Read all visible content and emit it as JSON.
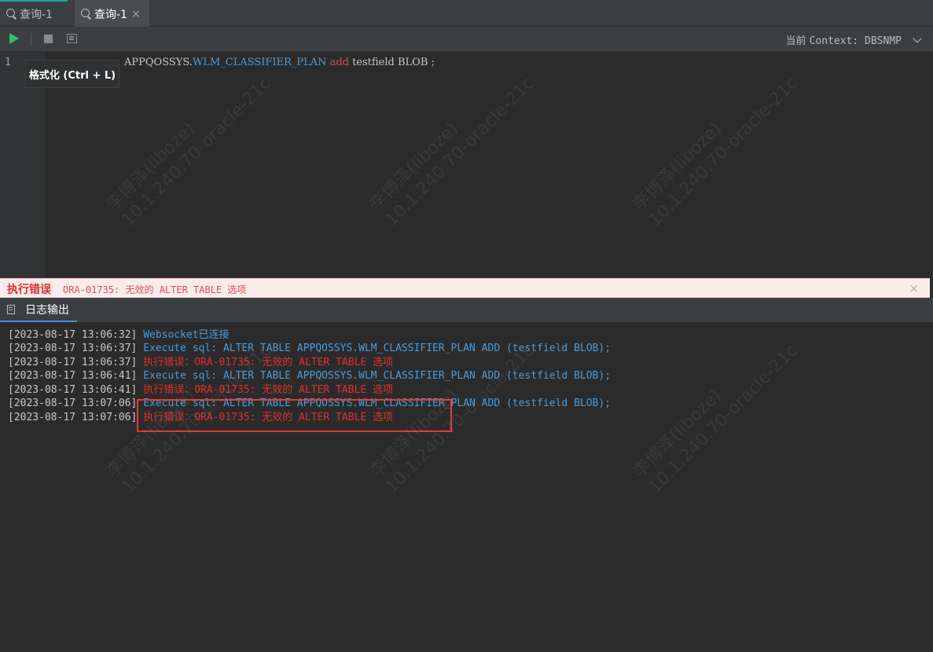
{
  "tabs": [
    {
      "label": "查询-1",
      "active": false
    },
    {
      "label": "查询-1",
      "active": true,
      "close": "×"
    }
  ],
  "toolbar": {
    "context_prefix": "当前",
    "context_label": "Context: DBSNMP"
  },
  "editor": {
    "line_number": "1",
    "code_schema": "APPQOSSYS.",
    "code_table": "WLM_CLASSIFIER_PLAN",
    "code_add": "add",
    "code_rest": " testfield BLOB ;",
    "tooltip": "格式化 (Ctrl + L)"
  },
  "error_bar": {
    "title": "执行错误",
    "message": "ORA-01735: 无效的 ALTER TABLE 选项",
    "close": "×"
  },
  "log_panel": {
    "tab_label": "日志输出",
    "lines": [
      {
        "ts": "[2023-08-17 13:06:32]",
        "text": "Websocket已连接",
        "level": "info"
      },
      {
        "ts": "[2023-08-17 13:06:37]",
        "text": "Execute sql: ALTER TABLE APPQOSSYS.WLM_CLASSIFIER_PLAN ADD (testfield BLOB);",
        "level": "info"
      },
      {
        "ts": "[2023-08-17 13:06:37]",
        "text": "执行错误：ORA-01735: 无效的 ALTER TABLE 选项",
        "level": "error"
      },
      {
        "ts": "[2023-08-17 13:06:41]",
        "text": "Execute sql: ALTER TABLE APPQOSSYS.WLM_CLASSIFIER_PLAN ADD (testfield BLOB);",
        "level": "info"
      },
      {
        "ts": "[2023-08-17 13:06:41]",
        "text": "执行错误：ORA-01735: 无效的 ALTER TABLE 选项",
        "level": "error"
      },
      {
        "ts": "[2023-08-17 13:07:06]",
        "text": "Execute sql: ALTER TABLE APPQOSSYS.WLM_CLASSIFIER_PLAN ADD (testfield BLOB);",
        "level": "info"
      },
      {
        "ts": "[2023-08-17 13:07:06]",
        "text": "执行错误：ORA-01735: 无效的 ALTER TABLE 选项",
        "level": "error"
      }
    ]
  },
  "watermark": {
    "line1": "李博泽(liboze)",
    "line2": "10.1.240.70-oracle-21c"
  },
  "colors": {
    "accent_green": "#2fbf71",
    "log_info": "#4a9bdb",
    "log_error": "#e03030",
    "highlight_box": "#e53935"
  }
}
